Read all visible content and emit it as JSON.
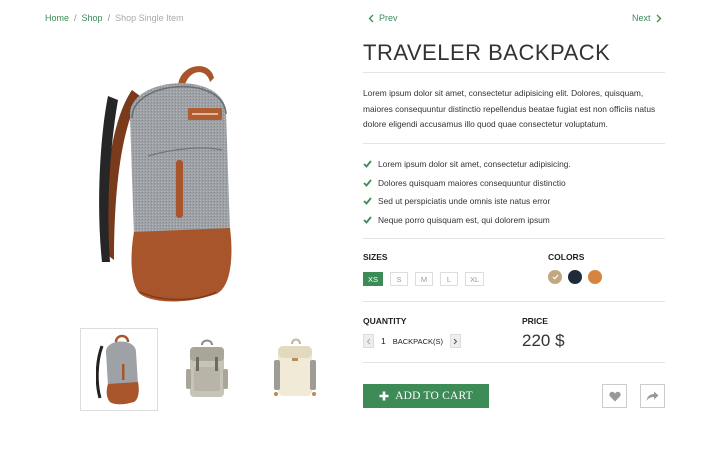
{
  "breadcrumb": {
    "home": "Home",
    "shop": "Shop",
    "current": "Shop Single Item",
    "separator": "/"
  },
  "pager": {
    "prev": "Prev",
    "next": "Next"
  },
  "product": {
    "title": "TRAVELER BACKPACK",
    "description": "Lorem ipsum dolor sit amet, consectetur adipisicing elit. Dolores, quisquam, maiores consequuntur distinctio repellendus beatae fugiat est non officiis natus dolore eligendi accusamus illo quod quae consectetur voluptatum.",
    "features": [
      "Lorem ipsum dolor sit amet, consectetur adipisicing.",
      "Dolores quisquam maiores consequuntur distinctio",
      "Sed ut perspiciatis unde omnis iste natus error",
      "Neque porro quisquam est, qui dolorem ipsum"
    ]
  },
  "sizes": {
    "label": "SIZES",
    "options": [
      "XS",
      "S",
      "M",
      "L",
      "XL"
    ],
    "selected": "XS"
  },
  "colors": {
    "label": "COLORS",
    "options": [
      "#c2a882",
      "#1d2b3a",
      "#d6843f"
    ],
    "selected_index": 0
  },
  "quantity": {
    "label": "QUANTITY",
    "value": "1",
    "unit": "BACKPACK(S)"
  },
  "price": {
    "label": "PRICE",
    "value": "220 $"
  },
  "actions": {
    "add_to_cart": "ADD TO CART"
  },
  "theme": {
    "accent": "#3d8b56"
  },
  "icons": [
    "chevron-left-icon",
    "chevron-right-icon",
    "check-icon",
    "plus-icon",
    "heart-icon",
    "share-icon"
  ]
}
